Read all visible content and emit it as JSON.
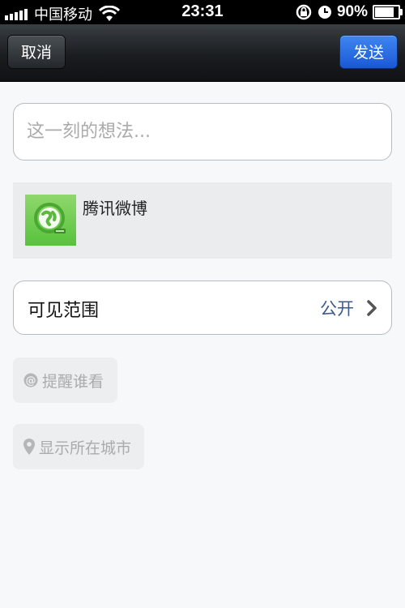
{
  "status_bar": {
    "carrier": "中国移动",
    "time": "23:31",
    "battery": "90%",
    "battery_level": 0.9
  },
  "nav": {
    "cancel_label": "取消",
    "send_label": "发送"
  },
  "composer": {
    "placeholder": "这一刻的想法..."
  },
  "share": {
    "title": "腾讯微博"
  },
  "visibility": {
    "label": "可见范围",
    "value": "公开"
  },
  "remind": {
    "label": "提醒谁看"
  },
  "location": {
    "label": "显示所在城市"
  },
  "colors": {
    "send_button": "#2a6ee6",
    "visibility_value": "#3d5a8a",
    "share_thumb": "#6ccc4c"
  }
}
